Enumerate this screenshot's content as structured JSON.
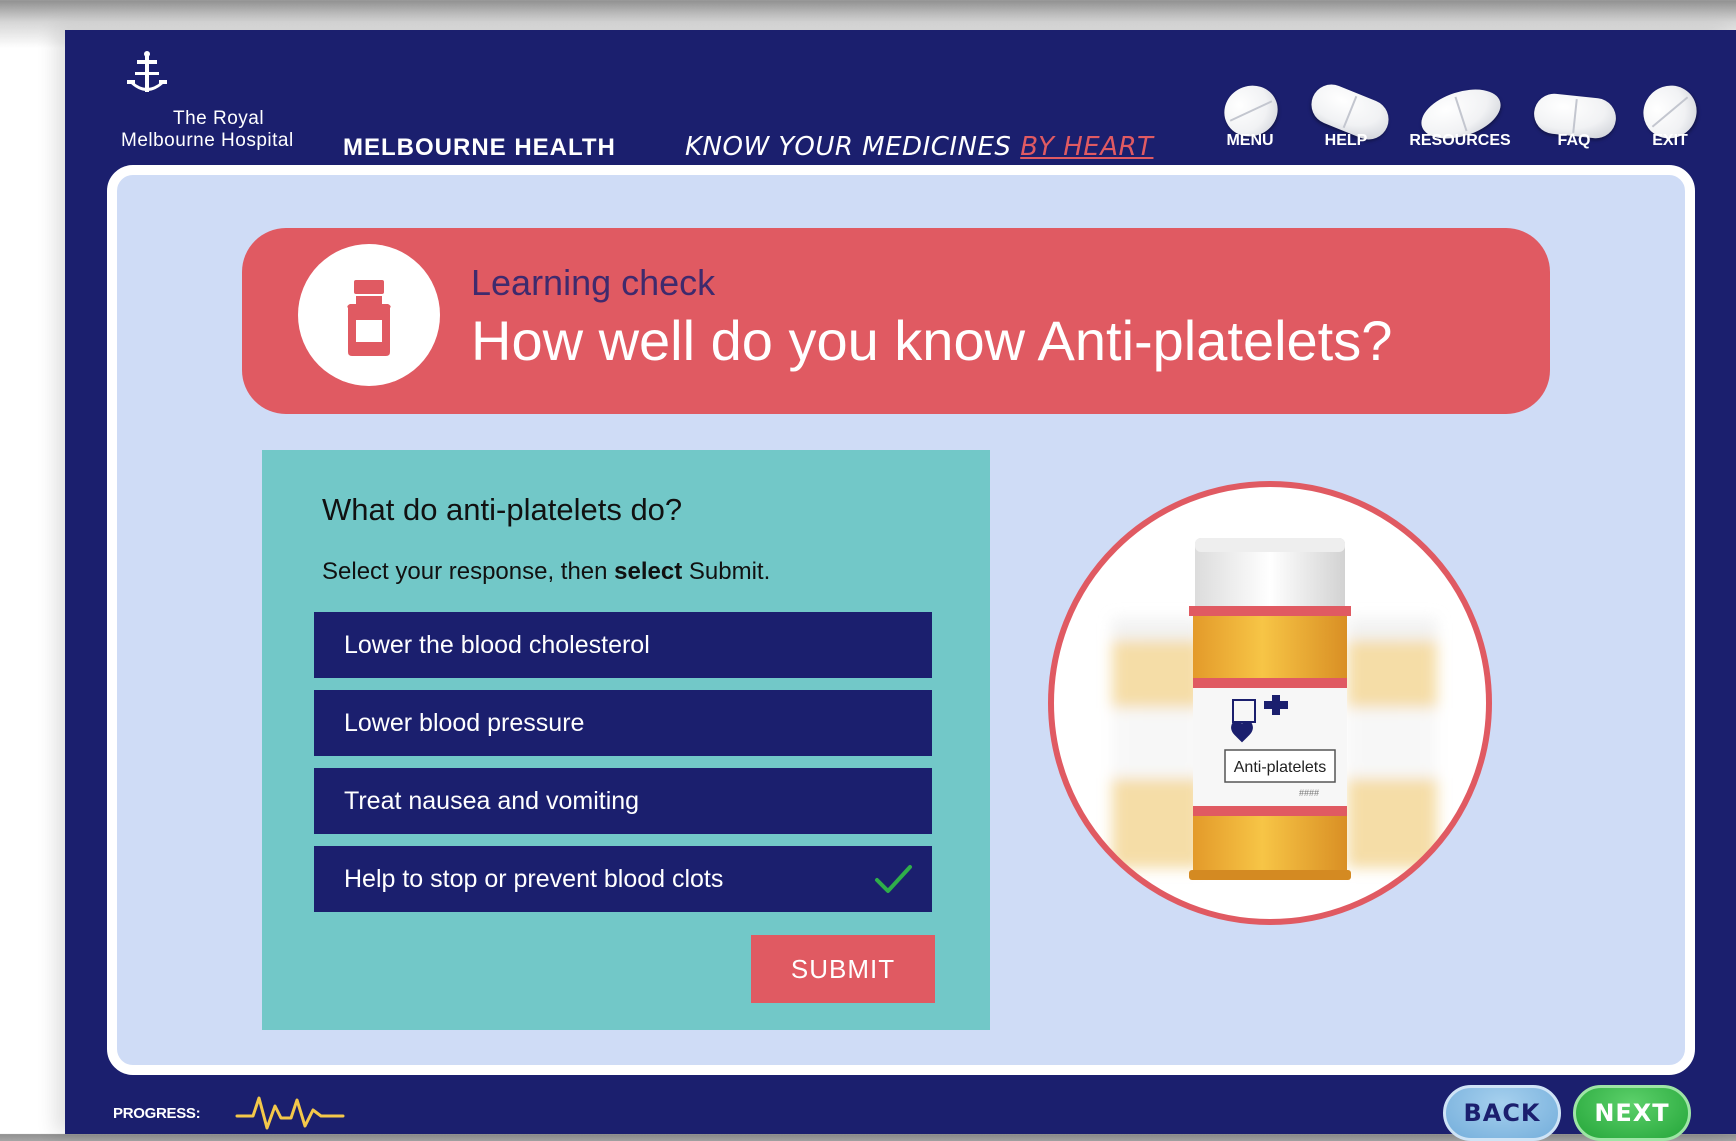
{
  "header": {
    "logo_line1": "The Royal",
    "logo_line2": "Melbourne Hospital",
    "org_name": "MELBOURNE HEALTH",
    "course_title_main": "KNOW YOUR MEDICINES ",
    "course_title_accent": "BY HEART",
    "nav": [
      {
        "label": "MENU",
        "icon": "round-pill-icon"
      },
      {
        "label": "HELP",
        "icon": "capsule-pill-icon"
      },
      {
        "label": "RESOURCES",
        "icon": "oval-pill-icon"
      },
      {
        "label": "FAQ",
        "icon": "capsule-pill-icon"
      },
      {
        "label": "EXIT",
        "icon": "round-pill-icon"
      }
    ]
  },
  "banner": {
    "icon": "medicine-bottle-icon",
    "kicker": "Learning check",
    "title": "How well do you know Anti-platelets?"
  },
  "question": {
    "title": "What do anti-platelets do?",
    "instruction_pre": "Select your response, then ",
    "instruction_bold": "select",
    "instruction_post": " Submit.",
    "options": [
      {
        "label": "Lower the blood cholesterol",
        "selected": false
      },
      {
        "label": "Lower blood pressure",
        "selected": false
      },
      {
        "label": "Treat nausea and vomiting",
        "selected": false
      },
      {
        "label": "Help to stop or prevent blood clots",
        "selected": true
      }
    ],
    "submit_label": "SUBMIT"
  },
  "image": {
    "bottle_label": "Anti-platelets",
    "bottle_sublabel": "####"
  },
  "footer": {
    "progress_label": "PROGRESS:",
    "progress_icon": "heartbeat-icon",
    "back_label": "BACK",
    "next_label": "NEXT"
  },
  "colors": {
    "navy": "#1b1f6e",
    "coral": "#e05a62",
    "teal": "#72c8c8",
    "panel_bg": "#cfdcf6",
    "check_green": "#2fae4a",
    "next_green": "#25a63a"
  }
}
